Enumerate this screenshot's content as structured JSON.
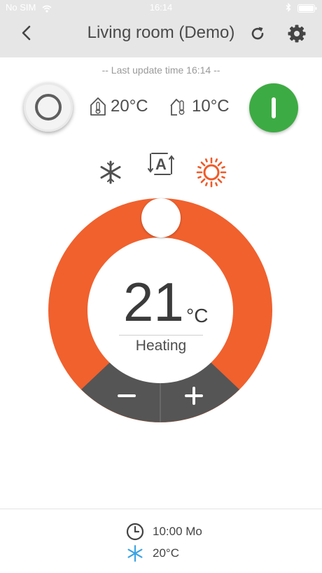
{
  "status_bar": {
    "carrier": "No SIM",
    "time": "16:14",
    "icons": [
      "wifi-icon",
      "bluetooth-icon",
      "battery-icon"
    ]
  },
  "header": {
    "title": "Living room (Demo)",
    "icons": [
      "back-chevron-icon",
      "refresh-icon",
      "gear-icon"
    ]
  },
  "last_update": "-- Last update time 16:14 --",
  "readings": {
    "indoor": {
      "icon": "room-thermometer-icon",
      "value": "20°C"
    },
    "outdoor": {
      "icon": "outdoor-thermometer-icon",
      "value": "10°C"
    }
  },
  "power": {
    "state": "on",
    "color": "#3dab43",
    "standby_icon": "standby-ring-icon"
  },
  "modes": {
    "items": [
      "snowflake-icon",
      "auto-mode-icon",
      "sun-icon"
    ],
    "active": "sun-icon",
    "active_color": "#f05a28"
  },
  "dial": {
    "target_temp": "21",
    "unit": "°C",
    "mode_label": "Heating",
    "ring_color": "#f0612e",
    "button_color": "#555555",
    "minus_label": "−",
    "plus_label": "+"
  },
  "schedule": {
    "time": "10:00 Mo",
    "temp": "20°C",
    "clock_icon": "clock-icon",
    "mode_icon": "snowflake-icon",
    "mode_icon_color": "#3ba3e4"
  }
}
